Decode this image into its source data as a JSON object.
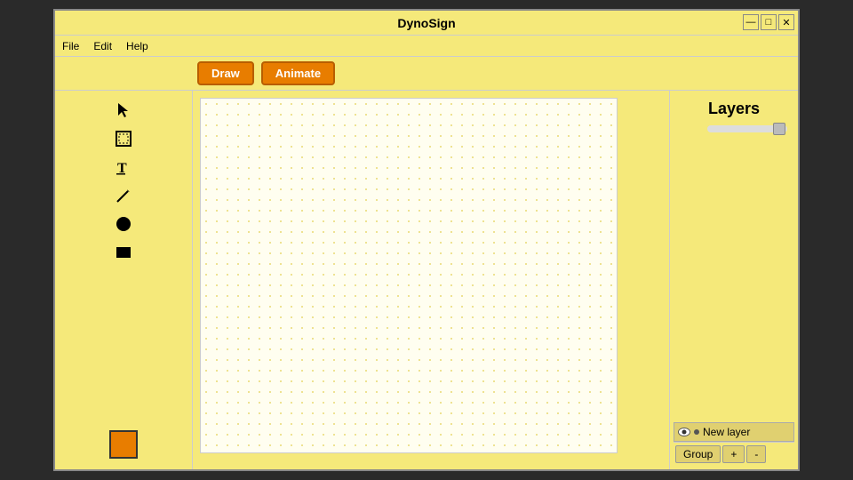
{
  "window": {
    "title": "DynoSign",
    "controls": {
      "minimize": "—",
      "restore": "□",
      "close": "✕"
    }
  },
  "menu": {
    "items": [
      "File",
      "Edit",
      "Help"
    ]
  },
  "toolbar": {
    "draw_label": "Draw",
    "animate_label": "Animate"
  },
  "tools": [
    {
      "name": "select-tool",
      "icon": "cursor"
    },
    {
      "name": "frame-tool",
      "icon": "frame"
    },
    {
      "name": "text-tool",
      "icon": "text"
    },
    {
      "name": "pen-tool",
      "icon": "pen"
    },
    {
      "name": "circle-tool",
      "icon": "circle"
    },
    {
      "name": "rect-tool",
      "icon": "rect"
    }
  ],
  "layers": {
    "title": "Layers",
    "new_layer_label": "New layer",
    "bottom_buttons": [
      "Group",
      "+",
      "-"
    ],
    "slider_value": 80
  },
  "color": {
    "current": "#e87d00"
  }
}
